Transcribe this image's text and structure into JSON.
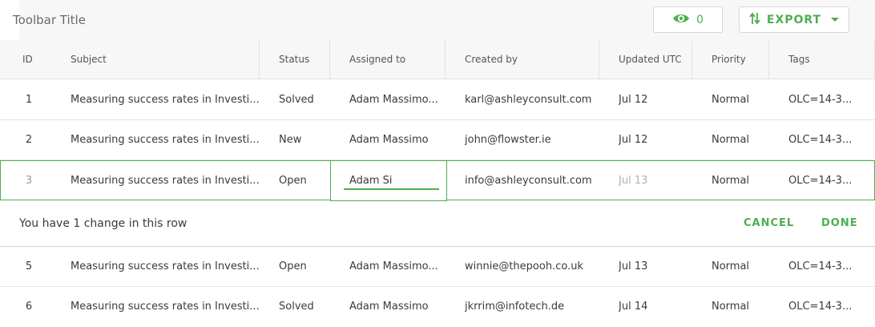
{
  "toolbar": {
    "title": "Toolbar Title",
    "views_count": "0",
    "export_label": "EXPORT",
    "accent_color": "#4caf50"
  },
  "table": {
    "columns": [
      "ID",
      "Subject",
      "Status",
      "Assigned to",
      "Created by",
      "Updated UTC",
      "Priority",
      "Tags"
    ],
    "rows": [
      {
        "id": "1",
        "subject": "Measuring success rates in Investi...",
        "status": "Solved",
        "assigned": "Adam Massimo...",
        "created_by": "karl@ashleyconsult.com",
        "updated": "Jul 12",
        "priority": "Normal",
        "tags": "OLC=14-3..."
      },
      {
        "id": "2",
        "subject": "Measuring success rates in Investi...",
        "status": "New",
        "assigned": "Adam Massimo",
        "created_by": "john@flowster.ie",
        "updated": "Jul 12",
        "priority": "Normal",
        "tags": "OLC=14-3..."
      },
      {
        "id": "3",
        "subject": "Measuring success rates in Investi...",
        "status": "Open",
        "assigned": "Adam Si",
        "created_by": "info@ashleyconsult.com",
        "updated": "Jul 13",
        "priority": "Normal",
        "tags": "OLC=14-3..."
      },
      {
        "id": "5",
        "subject": "Measuring success rates in Investi...",
        "status": "Open",
        "assigned": "Adam Massimo...",
        "created_by": "winnie@thepooh.co.uk",
        "updated": "Jul 13",
        "priority": "Normal",
        "tags": "OLC=14-3..."
      },
      {
        "id": "6",
        "subject": "Measuring success rates in Investi...",
        "status": "Solved",
        "assigned": "Adam Massimo",
        "created_by": "jkrrim@infotech.de",
        "updated": "Jul 14",
        "priority": "Normal",
        "tags": "OLC=14-3..."
      }
    ]
  },
  "edit_bar": {
    "message": "You have 1 change in this row",
    "cancel_label": "CANCEL",
    "done_label": "DONE"
  }
}
